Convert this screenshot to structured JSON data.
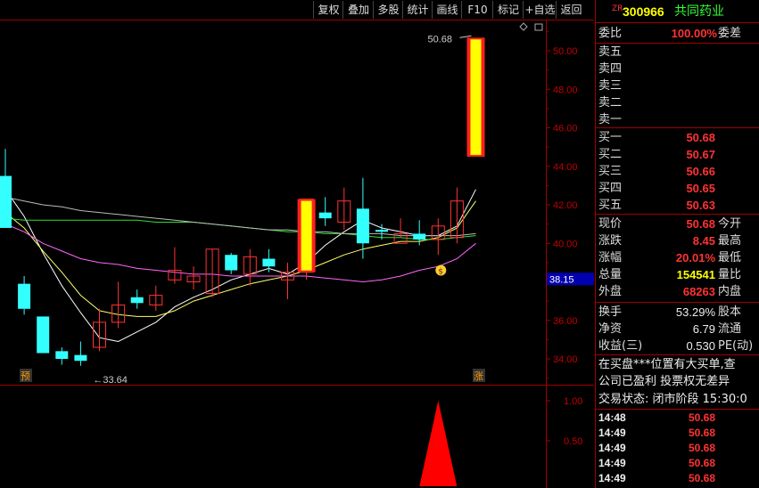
{
  "toolbar": {
    "buttons": [
      "复权",
      "叠加",
      "多股",
      "统计",
      "画线",
      "F10",
      "标记",
      "+自选",
      "返回"
    ]
  },
  "stock": {
    "badge": "ZR",
    "code": "300966",
    "name": "共同药业"
  },
  "chart": {
    "y_ticks": [
      "50.00",
      "48.00",
      "46.00",
      "44.00",
      "42.00",
      "40.00",
      "38.00",
      "36.00",
      "34.00"
    ],
    "current_price_tag": "38.15",
    "high_label": "50.68",
    "low_label": "33.64",
    "marker_pre": "预",
    "marker_up": "涨",
    "vol_ticks": [
      "1.00",
      "0.50"
    ],
    "icons": [
      "diamond-icon",
      "rectangle-icon"
    ]
  },
  "chart_data": {
    "type": "candlestick",
    "ylim": [
      33.0,
      51.0
    ],
    "candles": [
      {
        "o": 40.8,
        "c": 43.5,
        "h": 44.9,
        "l": 40.8,
        "up": false
      },
      {
        "o": 37.9,
        "c": 36.6,
        "h": 38.3,
        "l": 36.3,
        "up": false
      },
      {
        "o": 36.2,
        "c": 34.3,
        "h": 36.2,
        "l": 34.3,
        "up": false
      },
      {
        "o": 34.4,
        "c": 34.0,
        "h": 34.6,
        "l": 33.7,
        "up": false
      },
      {
        "o": 34.2,
        "c": 33.9,
        "h": 34.9,
        "l": 33.64,
        "up": false
      },
      {
        "o": 34.6,
        "c": 35.9,
        "h": 36.6,
        "l": 34.4,
        "up": true
      },
      {
        "o": 35.9,
        "c": 36.8,
        "h": 38.0,
        "l": 35.6,
        "up": true
      },
      {
        "o": 37.2,
        "c": 36.9,
        "h": 37.6,
        "l": 36.6,
        "up": false
      },
      {
        "o": 36.8,
        "c": 37.3,
        "h": 37.8,
        "l": 36.5,
        "up": true
      },
      {
        "o": 38.1,
        "c": 38.6,
        "h": 39.8,
        "l": 37.9,
        "up": true
      },
      {
        "o": 38.0,
        "c": 38.3,
        "h": 38.8,
        "l": 37.6,
        "up": true
      },
      {
        "o": 37.4,
        "c": 39.7,
        "h": 39.7,
        "l": 37.2,
        "up": true
      },
      {
        "o": 39.4,
        "c": 38.6,
        "h": 39.5,
        "l": 38.4,
        "up": false
      },
      {
        "o": 38.4,
        "c": 39.3,
        "h": 39.7,
        "l": 37.8,
        "up": true
      },
      {
        "o": 39.2,
        "c": 38.8,
        "h": 39.7,
        "l": 38.5,
        "up": false
      },
      {
        "o": 38.1,
        "c": 38.5,
        "h": 39.0,
        "l": 37.1,
        "up": true
      },
      {
        "o": 38.5,
        "c": 42.3,
        "h": 42.3,
        "l": 38.1,
        "up": true
      },
      {
        "o": 41.6,
        "c": 41.3,
        "h": 42.4,
        "l": 40.9,
        "up": false
      },
      {
        "o": 41.1,
        "c": 42.2,
        "h": 42.9,
        "l": 40.7,
        "up": true
      },
      {
        "o": 41.8,
        "c": 40.0,
        "h": 43.4,
        "l": 39.2,
        "up": false
      },
      {
        "o": 40.7,
        "c": 40.6,
        "h": 41.0,
        "l": 40.2,
        "up": false
      },
      {
        "o": 40.0,
        "c": 40.5,
        "h": 41.3,
        "l": 40.3,
        "up": true
      },
      {
        "o": 40.5,
        "c": 40.2,
        "h": 41.2,
        "l": 39.9,
        "up": false
      },
      {
        "o": 40.2,
        "c": 40.9,
        "h": 41.3,
        "l": 39.4,
        "up": true
      },
      {
        "o": 40.3,
        "c": 42.2,
        "h": 42.9,
        "l": 40.0,
        "up": true
      },
      {
        "o": 44.5,
        "c": 50.68,
        "h": 50.68,
        "l": 44.5,
        "up": true,
        "limit": true
      }
    ],
    "ma_lines": [
      {
        "color": "#ffffff",
        "values": [
          42.8,
          41.4,
          39.5,
          37.8,
          36.4,
          35.1,
          34.9,
          35.4,
          35.9,
          36.7,
          37.2,
          37.6,
          38.1,
          38.4,
          38.7,
          38.4,
          39.0,
          39.9,
          40.6,
          41.2,
          40.8,
          40.6,
          40.4,
          40.4,
          40.9,
          42.8
        ]
      },
      {
        "color": "#ffff66",
        "values": [
          41.6,
          40.8,
          39.6,
          38.5,
          37.3,
          36.5,
          36.3,
          36.2,
          36.2,
          36.5,
          37.0,
          37.3,
          37.6,
          37.9,
          38.1,
          38.3,
          38.6,
          39.0,
          39.4,
          39.7,
          39.9,
          40.1,
          40.1,
          40.3,
          40.8,
          42.2
        ]
      },
      {
        "color": "#ff66ff",
        "values": [
          41.0,
          40.6,
          40.0,
          39.6,
          39.2,
          39.0,
          38.9,
          38.7,
          38.6,
          38.5,
          38.4,
          38.4,
          38.3,
          38.3,
          38.3,
          38.3,
          38.3,
          38.2,
          38.1,
          38.0,
          38.1,
          38.3,
          38.6,
          38.8,
          39.2,
          40.0
        ]
      },
      {
        "color": "#33dd33",
        "values": [
          41.3,
          41.2,
          41.2,
          41.2,
          41.2,
          41.2,
          41.2,
          41.2,
          41.1,
          41.1,
          41.1,
          41.0,
          40.9,
          40.8,
          40.7,
          40.6,
          40.6,
          40.5,
          40.5,
          40.4,
          40.3,
          40.3,
          40.2,
          40.2,
          40.3,
          40.4
        ]
      },
      {
        "color": "#bbbbbb",
        "values": [
          42.4,
          42.2,
          42.0,
          41.9,
          41.7,
          41.6,
          41.5,
          41.4,
          41.3,
          41.2,
          41.1,
          41.0,
          40.9,
          40.8,
          40.7,
          40.7,
          40.6,
          40.6,
          40.5,
          40.5,
          40.5,
          40.4,
          40.4,
          40.4,
          40.4,
          40.5
        ]
      }
    ],
    "volume": {
      "ylim": [
        0,
        1.2
      ],
      "peak_index": 23,
      "peak_value": 1.0
    }
  },
  "panel": {
    "weibi": {
      "label": "委比",
      "value": "100.00%",
      "label2": "委差"
    },
    "sells": [
      {
        "label": "卖五"
      },
      {
        "label": "卖四"
      },
      {
        "label": "卖三"
      },
      {
        "label": "卖二"
      },
      {
        "label": "卖一"
      }
    ],
    "buys": [
      {
        "label": "买一",
        "price": "50.68"
      },
      {
        "label": "买二",
        "price": "50.67"
      },
      {
        "label": "买三",
        "price": "50.66"
      },
      {
        "label": "买四",
        "price": "50.65"
      },
      {
        "label": "买五",
        "price": "50.63"
      }
    ],
    "quotes": [
      {
        "label": "现价",
        "value": "50.68",
        "label2": "今开",
        "color": "red"
      },
      {
        "label": "涨跌",
        "value": "8.45",
        "label2": "最高",
        "color": "red"
      },
      {
        "label": "涨幅",
        "value": "20.01%",
        "label2": "最低",
        "color": "red"
      },
      {
        "label": "总量",
        "value": "154541",
        "label2": "量比",
        "color": "yel"
      },
      {
        "label": "外盘",
        "value": "68263",
        "label2": "内盘",
        "color": "red"
      }
    ],
    "stats": [
      {
        "label": "换手",
        "value": "53.29%",
        "label2": "股本"
      },
      {
        "label": "净资",
        "value": "6.79",
        "label2": "流通"
      },
      {
        "label": "收益(三)",
        "value": "0.530",
        "label2": "PE(动)"
      }
    ],
    "notes": [
      "在买盘***位置有大买单,查",
      "公司已盈利 投票权无差异"
    ],
    "trade_status": "交易状态: 闭市阶段 15:30:0",
    "ticks": [
      {
        "time": "14:48",
        "price": "50.68"
      },
      {
        "time": "14:49",
        "price": "50.68"
      },
      {
        "time": "14:49",
        "price": "50.68"
      },
      {
        "time": "14:49",
        "price": "50.68"
      },
      {
        "time": "14:49",
        "price": "50.68"
      }
    ]
  }
}
